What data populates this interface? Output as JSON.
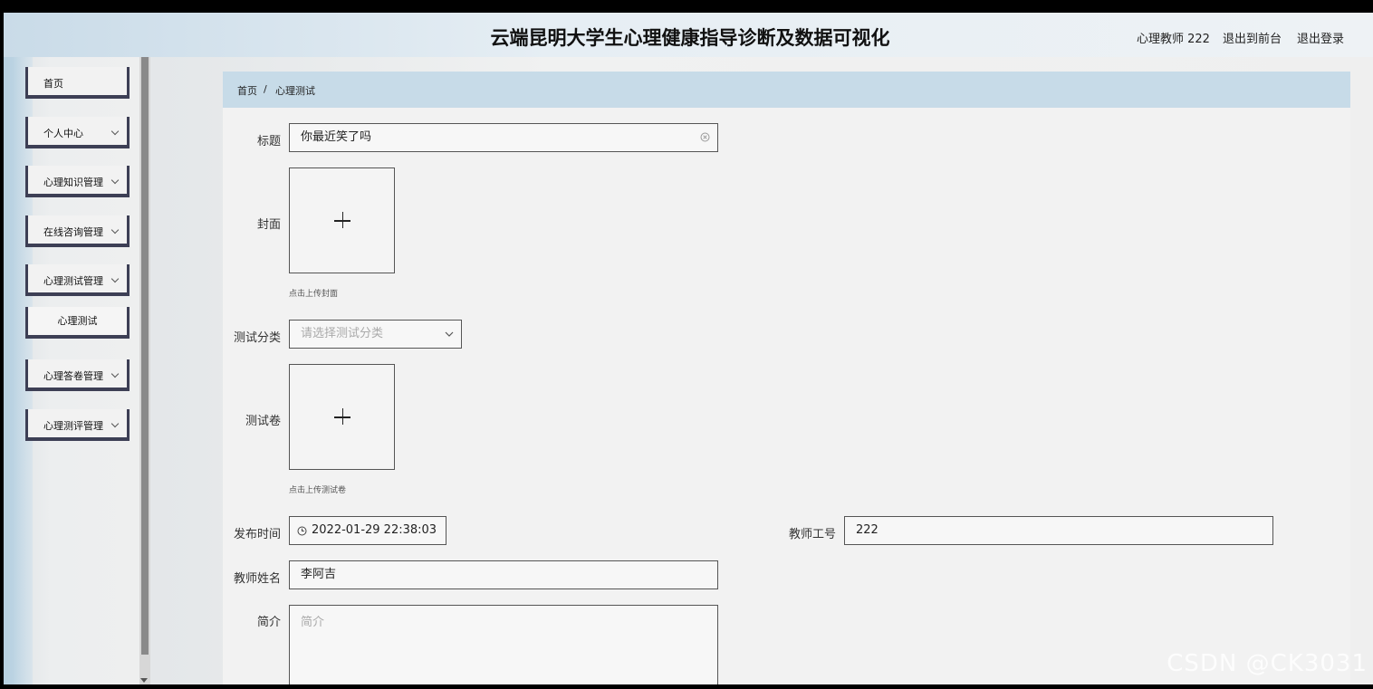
{
  "header": {
    "title": "云端昆明大学生心理健康指导诊断及数据可视化",
    "user_label": "心理教师 222",
    "back_to_front": "退出到前台",
    "logout": "退出登录"
  },
  "sidebar": {
    "items": [
      {
        "label": "首页"
      },
      {
        "label": "个人中心"
      },
      {
        "label": "心理知识管理"
      },
      {
        "label": "在线咨询管理"
      },
      {
        "label": "心理测试管理"
      },
      {
        "label": "心理测试"
      },
      {
        "label": "心理答卷管理"
      },
      {
        "label": "心理测评管理"
      }
    ]
  },
  "breadcrumb": {
    "home": "首页",
    "separator": "/",
    "current": "心理测试"
  },
  "form": {
    "title_label": "标题",
    "title_value": "你最近笑了吗",
    "cover_label": "封面",
    "cover_hint": "点击上传封面",
    "category_label": "测试分类",
    "category_placeholder": "请选择测试分类",
    "paper_label": "测试卷",
    "paper_hint": "点击上传测试卷",
    "publish_time_label": "发布时间",
    "publish_time_value": "2022-01-29 22:38:03",
    "teacher_id_label": "教师工号",
    "teacher_id_value": "222",
    "teacher_name_label": "教师姓名",
    "teacher_name_value": "李阿吉",
    "intro_label": "简介",
    "intro_placeholder": "简介"
  },
  "watermark": "CSDN @CK3031",
  "icons": {
    "clear": "circle-x-icon",
    "clock": "clock-icon",
    "dropdown": "chevron-down-icon",
    "upload": "plus-icon"
  }
}
